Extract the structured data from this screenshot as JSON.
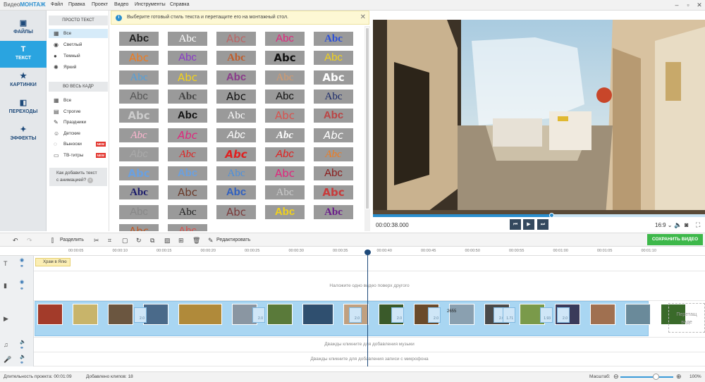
{
  "app": {
    "brand_prefix": "Видео",
    "brand_suffix": "МОНТАЖ"
  },
  "menu": [
    "Файл",
    "Правка",
    "Проект",
    "Видео",
    "Инструменты",
    "Справка"
  ],
  "nav": [
    {
      "label": "ФАЙЛЫ",
      "icon": "image-icon"
    },
    {
      "label": "ТЕКСТ",
      "icon": "text-icon"
    },
    {
      "label": "КАРТИНКИ",
      "icon": "star-icon"
    },
    {
      "label": "ПЕРЕХОДЫ",
      "icon": "transitions-icon"
    },
    {
      "label": "ЭФФЕКТЫ",
      "icon": "magic-wand-icon"
    }
  ],
  "categories": {
    "simple_header": "ПРОСТО ТЕКСТ",
    "simple": [
      {
        "label": "Все",
        "icon": "grid-icon"
      },
      {
        "label": "Светлый",
        "icon": "text-light-icon"
      },
      {
        "label": "Темный",
        "icon": "text-dark-icon"
      },
      {
        "label": "Яркий",
        "icon": "sun-icon"
      }
    ],
    "fullframe_header": "ВО ВЕСЬ КАДР",
    "fullframe": [
      {
        "label": "Все",
        "icon": "grid-icon"
      },
      {
        "label": "Строгие",
        "icon": "strict-icon"
      },
      {
        "label": "Праздники",
        "icon": "holiday-icon"
      },
      {
        "label": "Детские",
        "icon": "kids-icon"
      },
      {
        "label": "Выноски",
        "icon": "callout-icon",
        "badge": "NEW"
      },
      {
        "label": "ТВ-титры",
        "icon": "tv-icon",
        "badge": "NEW"
      }
    ],
    "howto_line1": "Как добавить текст",
    "howto_line2": "с анимацией?"
  },
  "info_message": "Выберите готовый стиль текста и перетащите его на монтажный стол.",
  "style_tiles": {
    "label": "Abc",
    "colors": [
      "#222",
      "#fff",
      "#b66",
      "#e0267d",
      "#2b4fd8",
      "#f07b1e",
      "#8a3ac8",
      "#c05c2a",
      "#111",
      "#f2d21b",
      "#4da0e0",
      "#f2d21b",
      "#8a3a8a",
      "#d89a6a",
      "#fff",
      "#555",
      "#444",
      "#111",
      "#111",
      "#1a2a6a",
      "#ccc",
      "#111",
      "#fff",
      "#d9534f",
      "#b44",
      "#ffb6d0",
      "#e0267d",
      "#fff",
      "#fff",
      "#fff",
      "#aaa",
      "#e02020",
      "#e02020",
      "#e02020",
      "#f07b1e",
      "#6aa0e0",
      "#6aa0e0",
      "#4a90e0",
      "#e0267d",
      "#8a1a1a",
      "#1a1a6a",
      "#6a3a2a",
      "#3060c0",
      "#ccc",
      "#c83a3a",
      "#888",
      "#222",
      "#7a3a3a",
      "#f2d21b",
      "#6a1a8a",
      "#c05c2a",
      "#d9534f"
    ]
  },
  "player": {
    "timecode": "00:00:38.000",
    "progress_pct": 54,
    "aspect_ratio": "16:9"
  },
  "toolbar": {
    "split_label": "Разделить",
    "edit_label": "Редактировать",
    "save_label": "СОХРАНИТЬ ВИДЕО"
  },
  "ruler": [
    "00:00:05",
    "00:00:10",
    "00:00:15",
    "00:00:20",
    "00:00:25",
    "00:00:30",
    "00:00:35",
    "00:00:40",
    "00:00:45",
    "00:00:50",
    "00:00:55",
    "00:01:00",
    "00:01:05",
    "00:01:10"
  ],
  "timeline": {
    "title_clip": "Храм в Ялю",
    "overlay_hint": "Наложите одно видео поверх другого",
    "music_hint": "Дважды кликните для добавления музыки",
    "mic_hint": "Дважды кликните для добавления записи с микрофона",
    "drop_line1": "Перетащ",
    "drop_line2": "виде",
    "transition_labels": [
      "2.0",
      "2.0",
      "2.0",
      "2.0",
      "2.0",
      "2.0",
      "1.71",
      "1.93",
      "2.0"
    ],
    "clip_overlay": "2655"
  },
  "status": {
    "duration_label": "Длительность проекта:",
    "duration_value": "00:01:09",
    "clips_label": "Добавлено клипов:",
    "clips_value": "18",
    "zoom_label": "Масштаб:",
    "zoom_value": "100%"
  }
}
